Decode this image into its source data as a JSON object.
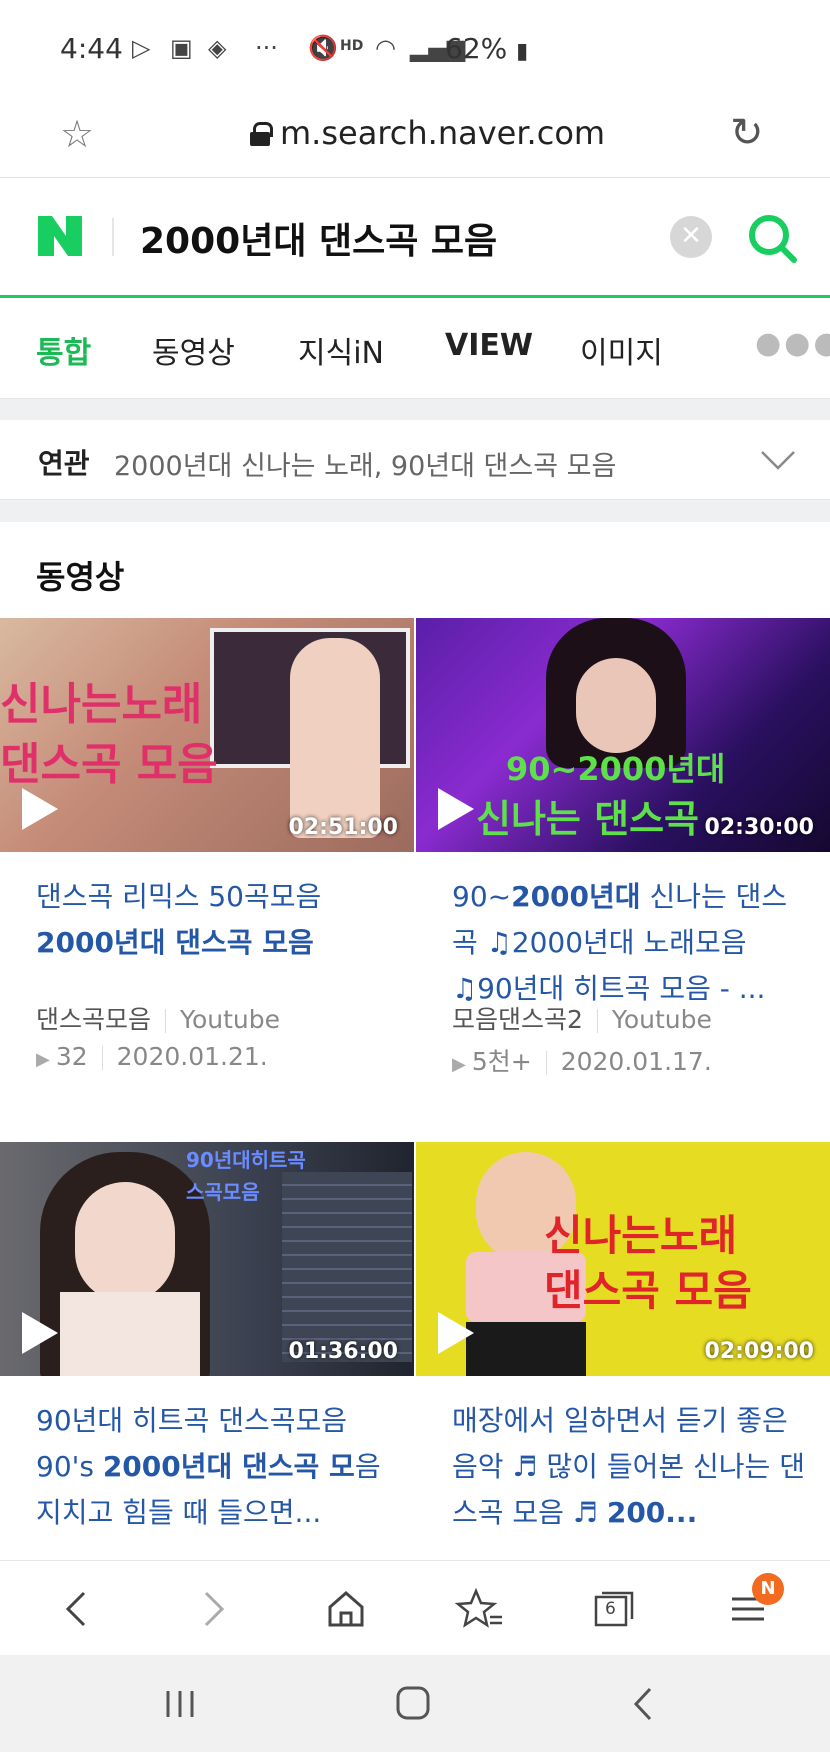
{
  "status_bar": {
    "time": "4:44",
    "battery": "62%"
  },
  "browser": {
    "url": "m.search.naver.com"
  },
  "search": {
    "query": "2000년대 댄스곡 모음",
    "clear_label": "✕"
  },
  "tabs": [
    {
      "label": "통합",
      "active": true
    },
    {
      "label": "동영상",
      "active": false
    },
    {
      "label": "지식iN",
      "active": false
    },
    {
      "label": "VIEW",
      "active": false
    },
    {
      "label": "이미지",
      "active": false
    }
  ],
  "related": {
    "label": "연관",
    "text": "2000년대 신나는 노래, 90년대 댄스곡 모음"
  },
  "videos_section": {
    "title": "동영상",
    "items": [
      {
        "duration": "02:51:00",
        "thumb_caption_1": "신나는노래",
        "thumb_caption_2": "댄스곡 모음",
        "title_a": "댄스곡 리믹스 50곡모음 ",
        "title_b": "2000년대 댄스곡 모음",
        "title_c": "",
        "channel": "댄스곡모음",
        "source": "Youtube",
        "views": "32",
        "date": "2020.01.21."
      },
      {
        "duration": "02:30:00",
        "thumb_caption_1": "90~2000년대",
        "thumb_caption_2": "신나는 댄스곡",
        "title_a": "90~",
        "title_b": "2000년대",
        "title_c": " 신나는 댄스곡 ♫2000년대 노래모음 ♫90년대 히트곡 모음 - ...",
        "channel": "모음댄스곡2",
        "source": "Youtube",
        "views": "5천+",
        "date": "2020.01.17."
      },
      {
        "duration": "01:36:00",
        "thumb_caption_1": "90년대히트곡",
        "thumb_caption_2": "스곡모음",
        "title_a": "90년대 히트곡 댄스곡모음 90's ",
        "title_b": "2000년대 댄스곡 모",
        "title_c": "음 지치고 힘들 때 들으면...",
        "channel": "",
        "source": "",
        "views": "",
        "date": ""
      },
      {
        "duration": "02:09:00",
        "thumb_caption_1": "신나는노래",
        "thumb_caption_2": "댄스곡 모음",
        "title_a": "매장에서 일하면서 듣기 좋은 음악 ♬ 많이 들어본 신나는 댄스곡 모음 ♬ ",
        "title_b": "200...",
        "title_c": "",
        "channel": "",
        "source": "",
        "views": "",
        "date": ""
      }
    ]
  },
  "bottom_nav": {
    "tabs_count": "6",
    "menu_badge": "N"
  },
  "colors": {
    "naver_green": "#19ce60",
    "link_blue": "#2557a7",
    "badge_orange": "#f26b21"
  }
}
